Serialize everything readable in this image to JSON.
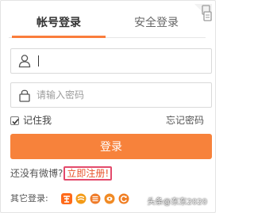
{
  "tabs": [
    {
      "label": "帐号登录",
      "active": true
    },
    {
      "label": "安全登录",
      "active": false
    }
  ],
  "username": {
    "value": "",
    "placeholder": "",
    "icon": "user-icon"
  },
  "password": {
    "value": "",
    "placeholder": "请输入密码",
    "icon": "lock-icon"
  },
  "remember": {
    "label": "记住我",
    "checked": true
  },
  "forgot_label": "忘记密码",
  "login_label": "登录",
  "register": {
    "question": "还没有微博?",
    "link": "立即注册!"
  },
  "other_login": {
    "label": "其它登录:",
    "providers": [
      "taobao-icon",
      "cmcc-icon",
      "sina-icon",
      "wangwang-icon",
      "refresh-icon"
    ]
  },
  "watermark": "头条@东东2020",
  "colors": {
    "accent": "#f7823b",
    "link": "#e8532b",
    "highlight_border": "#e34a6b"
  }
}
